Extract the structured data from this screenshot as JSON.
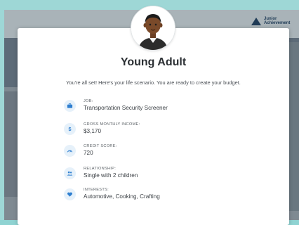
{
  "background": {
    "logo_text_line1": "Junior",
    "logo_text_line2": "Achievement"
  },
  "modal": {
    "title": "Young Adult",
    "subtitle": "You're all set! Here's your life scenario. You are ready to create your budget.",
    "details": [
      {
        "icon": "briefcase-icon",
        "label": "JOB:",
        "value": "Transportation Security Screener"
      },
      {
        "icon": "dollar-icon",
        "label": "GROSS MONTHLY INCOME:",
        "value": "$3,170"
      },
      {
        "icon": "gauge-icon",
        "label": "CREDIT SCORE:",
        "value": "720"
      },
      {
        "icon": "people-icon",
        "label": "RELATIONSHIP:",
        "value": "Single with 2 children"
      },
      {
        "icon": "heart-icon",
        "label": "INTERESTS:",
        "value": "Automotive, Cooking, Crafting"
      }
    ]
  },
  "colors": {
    "icon_bg": "#e6f1fa",
    "icon_fg": "#2f7fd0",
    "backdrop": "#9ed7d6"
  }
}
